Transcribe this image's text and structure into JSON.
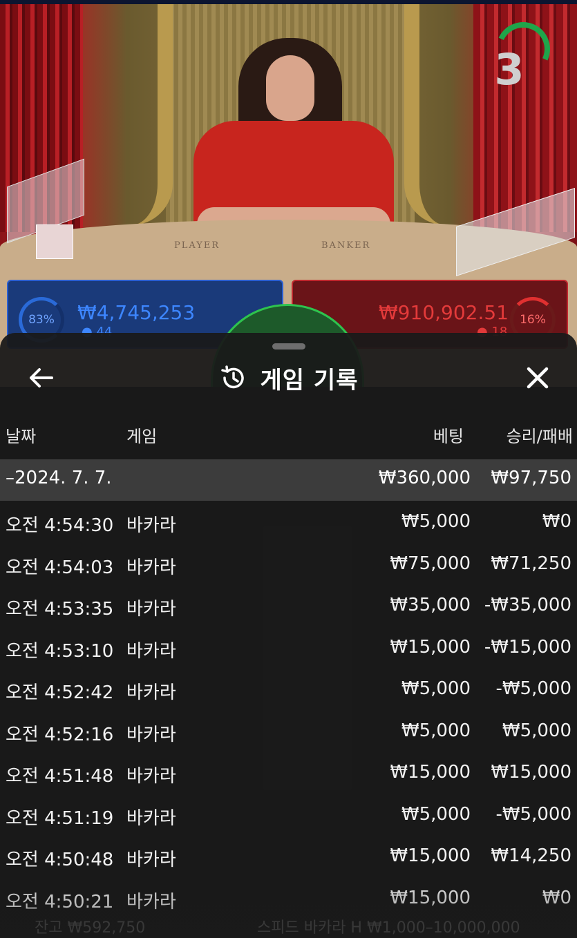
{
  "video": {
    "countdown": "3",
    "table_labels": {
      "player": "PLAYER",
      "banker": "BANKER"
    }
  },
  "bets": {
    "player": {
      "percent": "83%",
      "amount": "₩4,745,253",
      "players": "44"
    },
    "banker": {
      "percent": "16%",
      "amount": "₩910,902.51",
      "players": "18"
    }
  },
  "background_footer": {
    "balance": "잔고 ₩592,750",
    "table_name": "스피드 바카라 H  ₩1,000–10,000,000"
  },
  "history": {
    "title": "게임 기록",
    "columns": {
      "date": "날짜",
      "game": "게임",
      "bet": "베팅",
      "result": "승리/패배"
    },
    "date_group": {
      "label": "–2024. 7. 7.",
      "total_bet": "₩360,000",
      "total_result": "₩97,750"
    },
    "rows": [
      {
        "time": "오전 4:54:30",
        "game": "바카라",
        "bet": "₩5,000",
        "result": "₩0"
      },
      {
        "time": "오전 4:54:03",
        "game": "바카라",
        "bet": "₩75,000",
        "result": "₩71,250"
      },
      {
        "time": "오전 4:53:35",
        "game": "바카라",
        "bet": "₩35,000",
        "result": "-₩35,000"
      },
      {
        "time": "오전 4:53:10",
        "game": "바카라",
        "bet": "₩15,000",
        "result": "-₩15,000"
      },
      {
        "time": "오전 4:52:42",
        "game": "바카라",
        "bet": "₩5,000",
        "result": "-₩5,000"
      },
      {
        "time": "오전 4:52:16",
        "game": "바카라",
        "bet": "₩5,000",
        "result": "₩5,000"
      },
      {
        "time": "오전 4:51:48",
        "game": "바카라",
        "bet": "₩15,000",
        "result": "₩15,000"
      },
      {
        "time": "오전 4:51:19",
        "game": "바카라",
        "bet": "₩5,000",
        "result": "-₩5,000"
      },
      {
        "time": "오전 4:50:48",
        "game": "바카라",
        "bet": "₩15,000",
        "result": "₩14,250"
      },
      {
        "time": "오전 4:50:21",
        "game": "바카라",
        "bet": "₩15,000",
        "result": "₩0"
      }
    ]
  },
  "icons": {
    "back": "arrow-left-icon",
    "history": "history-icon",
    "close": "close-icon",
    "countdown": "timer-ring-icon"
  },
  "colors": {
    "player_blue": "#3d86ff",
    "banker_red": "#e33a3a",
    "tie_green": "#2ec44e",
    "sheet_bg": "#1a1a1a",
    "date_row_bg": "#3c3c3c"
  }
}
